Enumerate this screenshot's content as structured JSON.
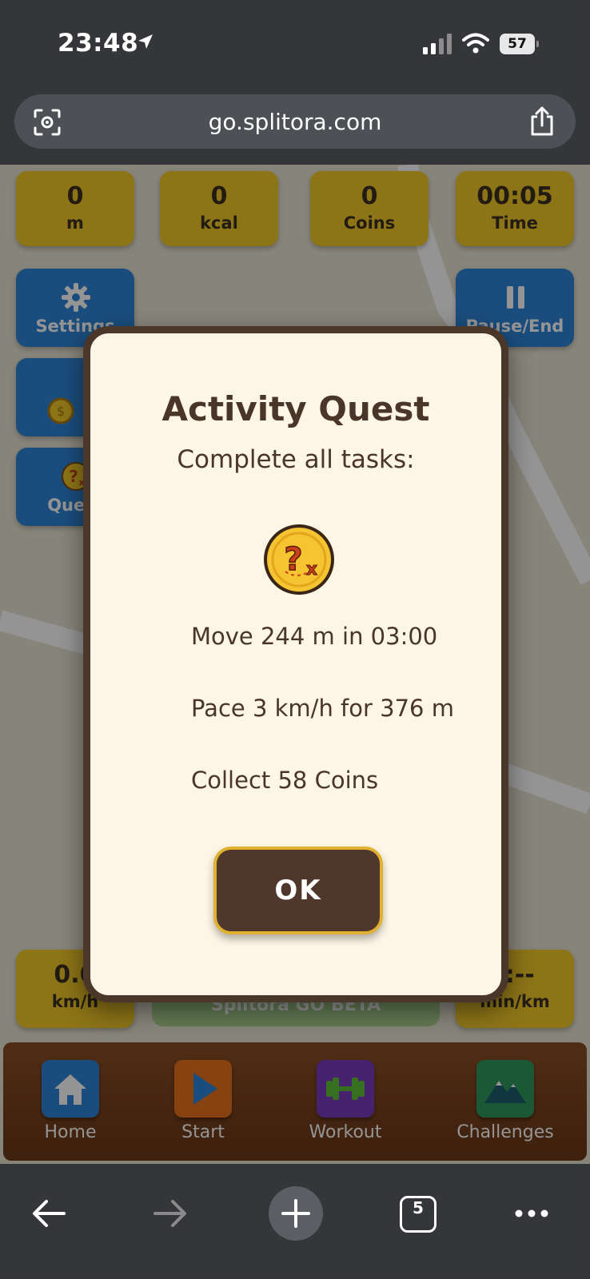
{
  "status": {
    "time": "23:48",
    "battery": "57"
  },
  "browser": {
    "url": "go.splitora.com",
    "tab_count": "5"
  },
  "stats": [
    {
      "value": "0",
      "label": "m"
    },
    {
      "value": "0",
      "label": "kcal"
    },
    {
      "value": "0",
      "label": "Coins"
    },
    {
      "value": "00:05",
      "label": "Time"
    }
  ],
  "side_buttons": {
    "settings": "Settings",
    "pause_end": "Pause/End",
    "quest": "Quest"
  },
  "bottom_stats": {
    "speed_value": "0.0",
    "speed_unit": "km/h",
    "pace_value": "-:--",
    "pace_unit": "min/km"
  },
  "beta_label": "Splitora GO BETA",
  "nav": [
    {
      "label": "Home",
      "color": "#2e86d8"
    },
    {
      "label": "Start",
      "color": "#e8731c"
    },
    {
      "label": "Workout",
      "color": "#7a3bc0"
    },
    {
      "label": "Challenges",
      "color": "#2f9a5e"
    }
  ],
  "modal": {
    "title": "Activity Quest",
    "subtitle": "Complete all tasks:",
    "tasks": [
      "Move 244 m in 03:00",
      "Pace 3 km/h for 376 m",
      "Collect 58 Coins"
    ],
    "ok_label": "OK",
    "icon": "quest-coin-icon"
  }
}
